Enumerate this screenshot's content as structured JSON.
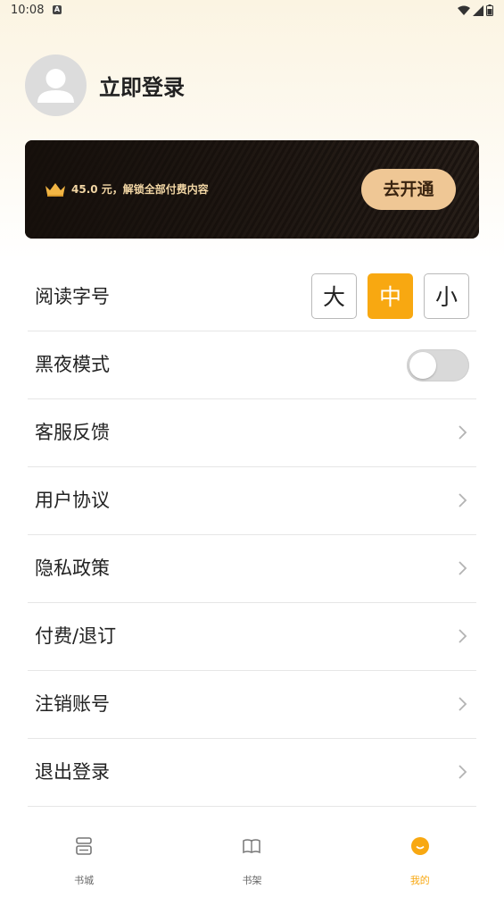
{
  "status": {
    "time": "10:08",
    "notification_icon": "A"
  },
  "profile": {
    "login_label": "立即登录"
  },
  "vip": {
    "text": "45.0 元，解锁全部付费内容",
    "button_label": "去开通",
    "accent": "#efc795"
  },
  "settings": {
    "font_size": {
      "label": "阅读字号",
      "options": [
        "大",
        "中",
        "小"
      ],
      "selected": "中"
    },
    "night_mode": {
      "label": "黑夜模式",
      "enabled": false
    },
    "items": [
      {
        "label": "客服反馈"
      },
      {
        "label": "用户协议"
      },
      {
        "label": "隐私政策"
      },
      {
        "label": "付费/退订"
      },
      {
        "label": "注销账号"
      },
      {
        "label": "退出登录"
      }
    ]
  },
  "tabs": [
    {
      "label": "书城",
      "icon": "bookstore-icon",
      "active": false
    },
    {
      "label": "书架",
      "icon": "bookshelf-icon",
      "active": false
    },
    {
      "label": "我的",
      "icon": "profile-smile-icon",
      "active": true
    }
  ],
  "colors": {
    "accent": "#f8a811"
  }
}
